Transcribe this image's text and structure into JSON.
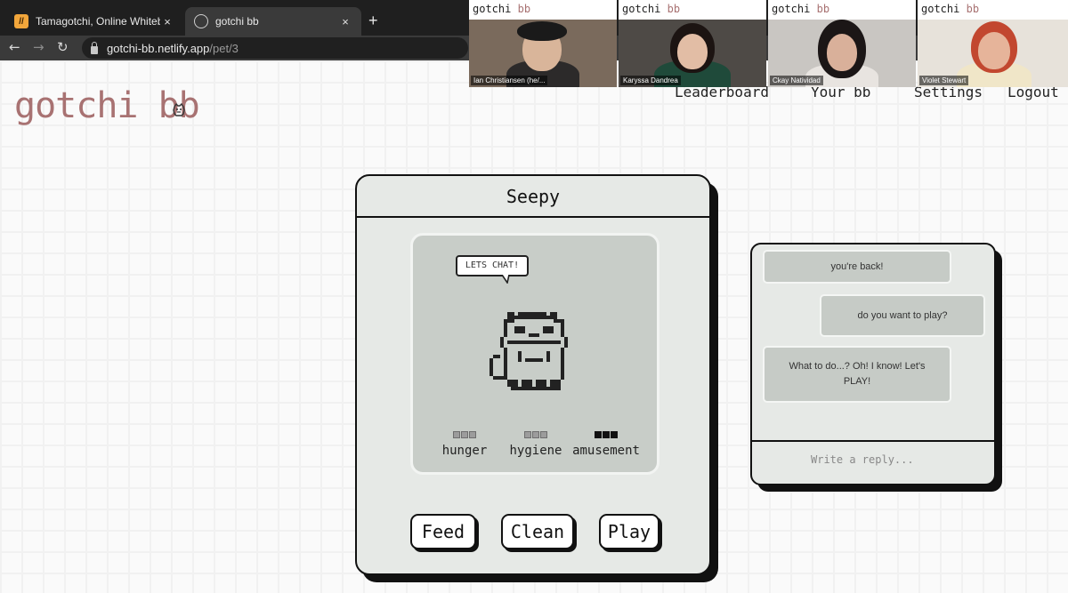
{
  "browser": {
    "tabs": [
      {
        "title": "Tamagotchi, Online Whiteboard",
        "close": "×"
      },
      {
        "title": "gotchi bb",
        "close": "×"
      }
    ],
    "new_tab": "+",
    "url_host": "gotchi-bb.netlify.app",
    "url_path": "/pet/3"
  },
  "app": {
    "logo": "gotchi bb",
    "nav": [
      "Leaderboard",
      "Your bb",
      "Settings",
      "Logout"
    ]
  },
  "video_call": {
    "brand": "gotchi",
    "brand_accent": "bb",
    "participants": [
      {
        "name": "Ian Christiansen (he/..."
      },
      {
        "name": "Karyssa Dandrea"
      },
      {
        "name": "Ckay Natividad"
      },
      {
        "name": "Violet Stewart"
      }
    ]
  },
  "pet": {
    "name": "Seepy",
    "speech": "LETS CHAT!",
    "stats": [
      {
        "label": "hunger",
        "level": 0
      },
      {
        "label": "hygiene",
        "level": 0
      },
      {
        "label": "amusement",
        "level": 3
      }
    ],
    "actions": [
      "Feed",
      "Clean",
      "Play"
    ]
  },
  "chat": {
    "messages": [
      {
        "text": "you're back!",
        "from": "pet"
      },
      {
        "text": "do you want to play?",
        "from": "user"
      },
      {
        "text": "What to do...? Oh! I know! Let's PLAY!",
        "from": "pet"
      }
    ],
    "reply_placeholder": "Write a reply..."
  },
  "colors": {
    "brand": "#a87272",
    "card_bg": "#e6e9e6",
    "screen_bg": "#c8cdc8",
    "outline": "#111111"
  }
}
